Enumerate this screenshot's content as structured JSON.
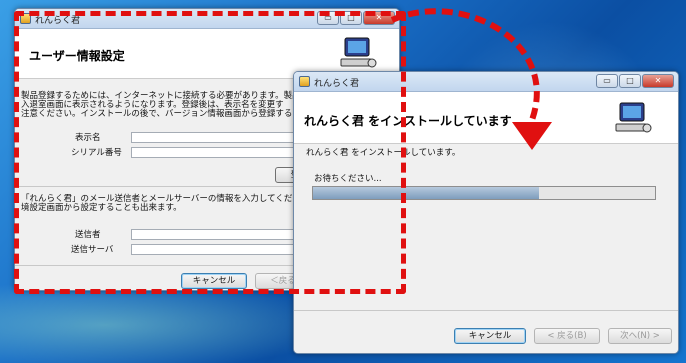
{
  "back_window": {
    "title": "れんらく君",
    "header_title": "ユーザー情報設定",
    "intro_lines": [
      "製品登録するためには、インターネットに接続する必要があります。製品",
      "入退室画面に表示されるようになります。登録後は、表示名を変更す",
      "注意ください。インストールの後で、バージョン情報画面から登録するこ"
    ],
    "display_name_label": "表示名",
    "serial_label": "シリアル番号",
    "mid_button_label": "登",
    "mail_lines": [
      "「れんらく君」のメール送信者とメールサーバーの情報を入力してくださ",
      "境設定画面から設定することも出来ます。"
    ],
    "sender_label": "送信者",
    "server_label": "送信サーバ",
    "cancel_label": "キャンセル",
    "back_label": "＜戻る"
  },
  "front_window": {
    "title": "れんらく君",
    "header_title": "れんらく君 をインストールしています",
    "status_text": "れんらく君 をインストールしています。",
    "wait_text": "お待ちください...",
    "progress_fraction": 0.66,
    "cancel_label": "キャンセル",
    "back_label": "< 戻る(B)",
    "next_label": "次へ(N) >"
  },
  "window_buttons": {
    "minimize": "▭",
    "maximize": "□",
    "close": "✕"
  },
  "colors": {
    "annotation_red": "#e01010",
    "accent": "#3c7fb1"
  }
}
